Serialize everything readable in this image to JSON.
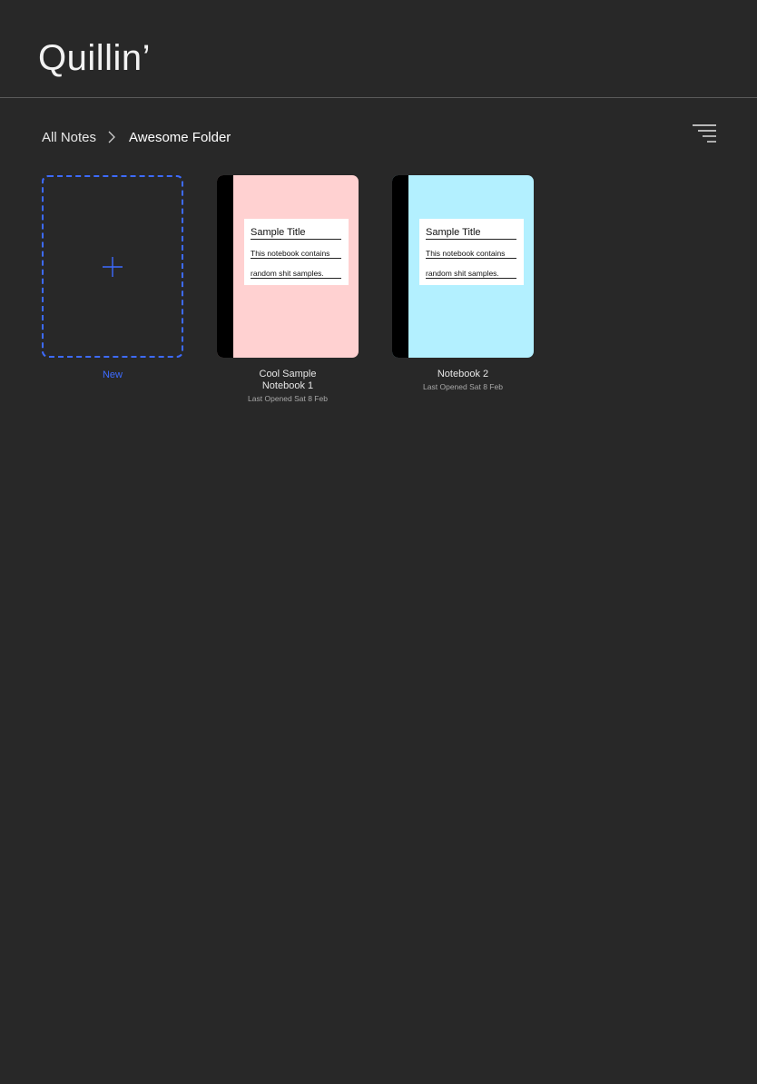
{
  "app": {
    "title": "Quillin’"
  },
  "breadcrumb": {
    "root": "All Notes",
    "current": "Awesome Folder"
  },
  "new_tile": {
    "label": "New",
    "accent": "#3d6bff",
    "icon": "plus-icon"
  },
  "notebooks": [
    {
      "name": "Cool Sample Notebook 1",
      "last_opened": "Last Opened Sat 8 Feb",
      "cover_color": "#ffd1d1",
      "cover_title": "Sample Title",
      "cover_line1": "This notebook contains",
      "cover_line2": "random shit samples."
    },
    {
      "name": "Notebook 2",
      "last_opened": "Last Opened Sat 8 Feb",
      "cover_color": "#b3f0ff",
      "cover_title": "Sample Title",
      "cover_line1": "This notebook contains",
      "cover_line2": "random shit samples."
    }
  ],
  "toolbar": {
    "menu_icon": "menu-lines-icon"
  }
}
